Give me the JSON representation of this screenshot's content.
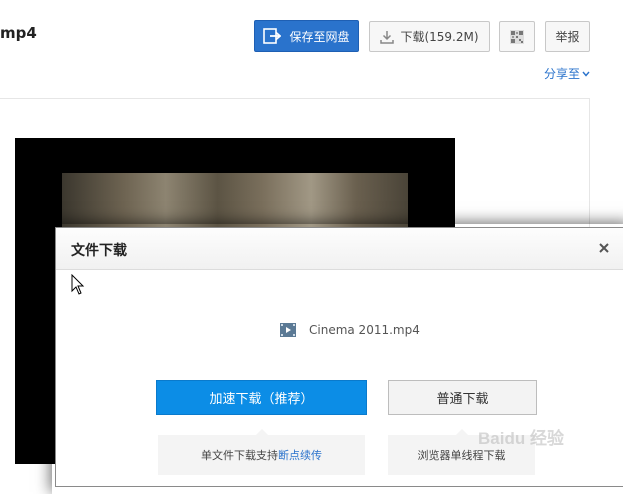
{
  "header": {
    "file_title": "mp4",
    "save_button": "保存至网盘",
    "download_button": "下载(159.2M)",
    "report_button": "举报",
    "share_link": "分享至"
  },
  "icons": {
    "save": "save-to-cloud-icon",
    "download": "download-icon",
    "qr": "qr-code-icon",
    "chevron": "chevron-down-icon",
    "close": "close-icon",
    "video": "video-file-icon",
    "cursor": "mouse-cursor-icon",
    "watermark": "baidu-jingyan-logo"
  },
  "modal": {
    "title": "文件下载",
    "file_name": "Cinema 2011.mp4",
    "accelerated_button": "加速下载（推荐）",
    "normal_button": "普通下载",
    "tip_left_prefix": "单文件下载支持",
    "tip_left_highlight": "断点续传",
    "tip_right": "浏览器单线程下载"
  },
  "watermark": {
    "text": "Baidu 经验"
  },
  "colors": {
    "primary_blue": "#2a73cc",
    "accel_blue": "#0c8de6",
    "link_blue": "#2a73cc"
  }
}
